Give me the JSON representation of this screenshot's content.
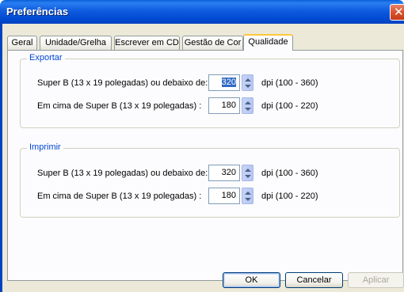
{
  "window": {
    "title": "Preferências",
    "close_glyph": "✕"
  },
  "tabs": [
    {
      "label": "Geral",
      "active": false
    },
    {
      "label": "Unidade/Grelha",
      "active": false
    },
    {
      "label": "Escrever em CD",
      "active": false
    },
    {
      "label": "Gestão de Cor",
      "active": false
    },
    {
      "label": "Qualidade",
      "active": true
    }
  ],
  "export_group": {
    "title": "Exportar",
    "row1": {
      "label": "Super B (13 x 19 polegadas) ou debaixo de:",
      "value": "320",
      "range": "dpi (100 - 360)"
    },
    "row2": {
      "label": "Em cima de Super B (13 x 19 polegadas) :",
      "value": "180",
      "range": "dpi (100 - 220)"
    }
  },
  "print_group": {
    "title": "Imprimir",
    "row1": {
      "label": "Super B (13 x 19 polegadas) ou debaixo de:",
      "value": "320",
      "range": "dpi (100 - 360)"
    },
    "row2": {
      "label": "Em cima de Super B (13 x 19 polegadas) :",
      "value": "180",
      "range": "dpi (100 - 220)"
    }
  },
  "buttons": {
    "ok": "OK",
    "cancel": "Cancelar",
    "apply": "Aplicar"
  },
  "icons": {
    "close": "close-icon",
    "spinner_up": "chevron-up-icon",
    "spinner_down": "chevron-down-icon"
  },
  "colors": {
    "titlebar": "#0a5fd8",
    "window_bg": "#ece9d8",
    "group_title": "#0046d5",
    "selection": "#316ac5",
    "active_tab_accent": "#ffc83c"
  }
}
